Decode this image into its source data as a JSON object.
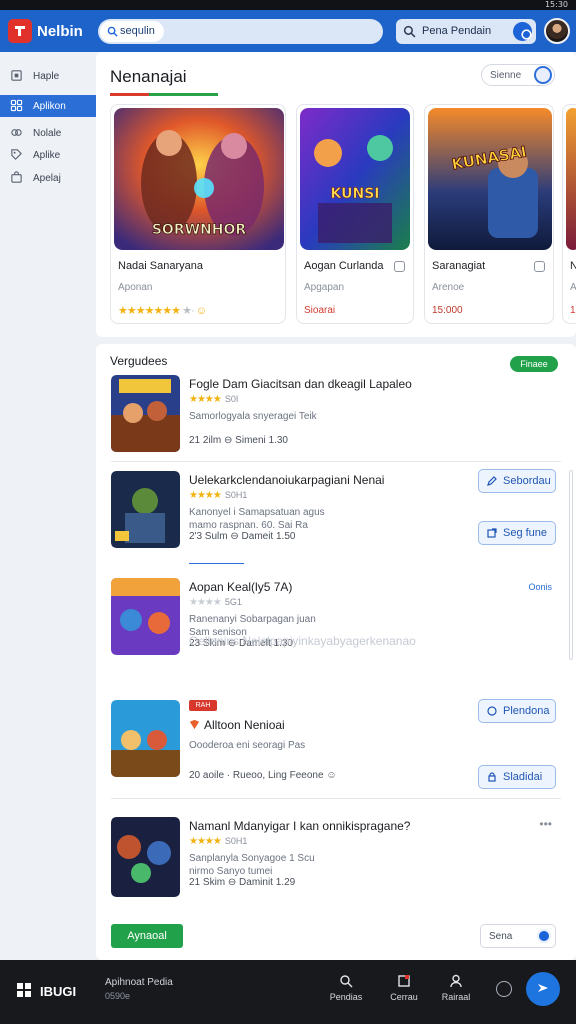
{
  "status_bar": {
    "time": "15:30"
  },
  "header": {
    "app_title": "Nelbin",
    "search_chip": "sequlin",
    "search_placeholder": "",
    "right_search_label": "Pena Pendain"
  },
  "sidebar": {
    "items": [
      {
        "label": "Haple",
        "icon": "home-icon"
      },
      {
        "label": "Aplikon",
        "icon": "grid-icon",
        "active": true
      },
      {
        "label": "Nolale",
        "icon": "link-icon"
      },
      {
        "label": "Aplike",
        "icon": "tag-icon"
      },
      {
        "label": "Apelaj",
        "icon": "bag-icon"
      }
    ]
  },
  "featured": {
    "title": "Nenanajai",
    "search_label": "Sienne",
    "cards": [
      {
        "name": "Nadai Sanaryana",
        "sub": "Aponan",
        "stars": "★★★★★★★",
        "extra": "★·"
      },
      {
        "name": "Aogan Curlanda",
        "sub": "Apgapan",
        "price": "Sioarai"
      },
      {
        "name": "Saranagiat",
        "sub": "Arenoe",
        "price": "15:000"
      },
      {
        "name": "N",
        "sub": "A",
        "price": "1"
      }
    ],
    "card_art_text": [
      "SORWNHOR",
      "KUNSI",
      "KUNASAI"
    ]
  },
  "list": {
    "title": "Vergudees",
    "badge": "Finaee",
    "items": [
      {
        "title": "Fogle Dam Giacitsan dan dkeagil Lapaleo",
        "stars": "★★★★",
        "rating": "S0I",
        "desc": [
          "Samorlogyala snyeragei Teik"
        ],
        "meta": "21 2ilm   ⊖ Simeni 1.30"
      },
      {
        "title": "Uelekarkclendanoiukarpagiani Nenai",
        "stars": "★★★★",
        "rating": "S0H1",
        "desc": [
          "Kanonyel i Samapsatuan agus",
          "mamo raspnan. 60. Sai Ra"
        ],
        "meta": "2'3 Sulm   ⊖ Dameit 1.50",
        "buttons": [
          "Sebordau",
          "Seg fune"
        ]
      },
      {
        "title": "Aopan Keal(ly5 7A)",
        "stars": "★★★★",
        "rating": "5G1",
        "desc": [
          "Ranenanyi Sobarpagan juan",
          "Sam senison"
        ],
        "meta": "23 Skim   ⊖ Damelt 1.30",
        "more": "Oonis"
      },
      {
        "tag": "RAH",
        "title": "Alltoon Nenioai",
        "desc": [
          "Oooderoa eni seoragi Pas"
        ],
        "meta": "20 aoile · Rueoo, Ling Feeone ☺",
        "buttons": [
          "Plendona",
          "Sladidai"
        ]
      },
      {
        "title": "Namanl Mdanyigar I kan onnikispragane?",
        "stars": "★★★★",
        "rating": "S0H1",
        "desc": [
          "Sanplanyla Sonyagoe 1 Scu",
          "nirmo Sanyo tumei"
        ],
        "meta": "21 Skim   ⊖ Daminit 1.29"
      }
    ],
    "watermark": "Oellenins Nelelpapiyinkayabyagerkenanao",
    "green_button": "Aynaoal",
    "pager_label": "Sena"
  },
  "bottom_bar": {
    "brand": "IBUGI",
    "app_name": "Apihnoat Pedia",
    "app_sub": "0590e",
    "tabs": [
      {
        "label": "Pendias",
        "icon": "search-icon"
      },
      {
        "label": "Cerrau",
        "icon": "edit-icon"
      },
      {
        "label": "Rairaal",
        "icon": "person-icon"
      }
    ]
  },
  "colors": {
    "header_blue": "#1e63c9",
    "accent_red": "#e0322b",
    "accent_green": "#21a24a",
    "star_yellow": "#f2b20f"
  }
}
